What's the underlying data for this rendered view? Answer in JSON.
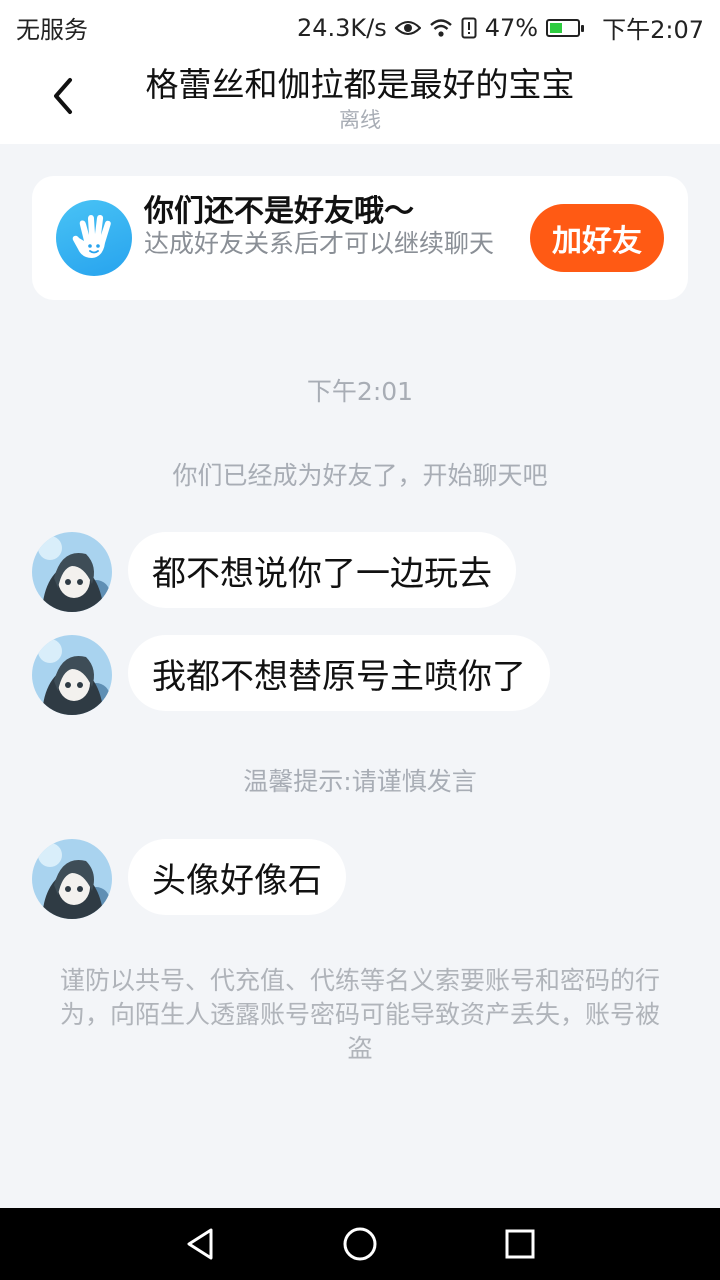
{
  "status_bar": {
    "carrier": "无服务",
    "speed": "24.3K/s",
    "battery": "47%",
    "battery_level": 0.47,
    "time": "下午2:07",
    "icons": [
      "eye-icon",
      "wifi-icon",
      "sim-alert-icon",
      "battery-icon"
    ]
  },
  "header": {
    "title": "格蕾丝和伽拉都是最好的宝宝",
    "status": "离线"
  },
  "friend_card": {
    "title": "你们还不是好友哦～",
    "description": "达成好友关系后才可以继续聊天",
    "button": "加好友",
    "accent": "#ff5a14",
    "icon": "hand-wave-icon"
  },
  "chat": {
    "time": "下午2:01",
    "system_friend": "你们已经成为好友了，开始聊天吧",
    "messages": [
      {
        "text": "都不想说你了一边玩去"
      },
      {
        "text": "我都不想替原号主喷你了"
      },
      {
        "text": "头像好像石"
      }
    ],
    "tip": "温馨提示:请谨慎发言",
    "warning": "谨防以共号、代充值、代练等名义索要账号和密码的行为，向陌生人透露账号密码可能导致资产丢失，账号被盗"
  },
  "nav_bar": {
    "icons": [
      "back-triangle-icon",
      "home-circle-icon",
      "recents-square-icon"
    ]
  }
}
